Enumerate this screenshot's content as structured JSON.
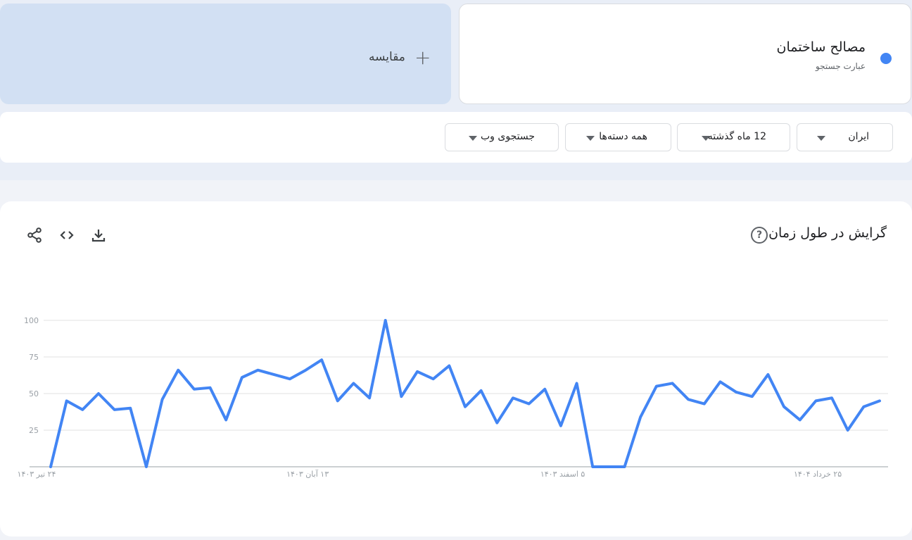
{
  "search_term": {
    "title": "مصالح ساختمان",
    "subtitle": "عبارت جستجو",
    "color": "#4285f4"
  },
  "compare": {
    "label": "مقایسه",
    "icon": "plus-icon"
  },
  "filters": {
    "region": "ایران",
    "time_range": "12 ماه گذشته",
    "category": "همه دسته‌ها",
    "search_type": "جستجوی وب"
  },
  "chart": {
    "title": "گرایش در طول زمان",
    "help_icon": "?",
    "tools": [
      "share-icon",
      "embed-icon",
      "download-icon"
    ]
  },
  "chart_data": {
    "type": "line",
    "series_color": "#4285f4",
    "ylim": [
      0,
      100
    ],
    "yticks": [
      "100",
      "75",
      "50",
      "25"
    ],
    "ytick_values": [
      100,
      75,
      50,
      25
    ],
    "xtick_labels": [
      "۲۴ تیر ۱۴۰۳",
      "۱۳ آبان ۱۴۰۳",
      "۵ اسفند ۱۴۰۳",
      "۲۵ خرداد ۱۴۰۴"
    ],
    "xtick_indices": [
      0,
      17,
      33,
      49
    ],
    "grid": true,
    "series": [
      {
        "values": [
          0,
          45,
          39,
          50,
          39,
          40,
          0,
          46,
          66,
          53,
          54,
          32,
          61,
          66,
          63,
          60,
          66,
          73,
          45,
          57,
          47,
          100,
          48,
          65,
          60,
          69,
          41,
          52,
          30,
          47,
          43,
          53,
          28,
          57,
          0,
          0,
          0,
          34,
          55,
          57,
          46,
          43,
          58,
          51,
          48,
          63,
          41,
          32,
          45,
          47,
          25,
          41,
          45
        ]
      }
    ]
  }
}
